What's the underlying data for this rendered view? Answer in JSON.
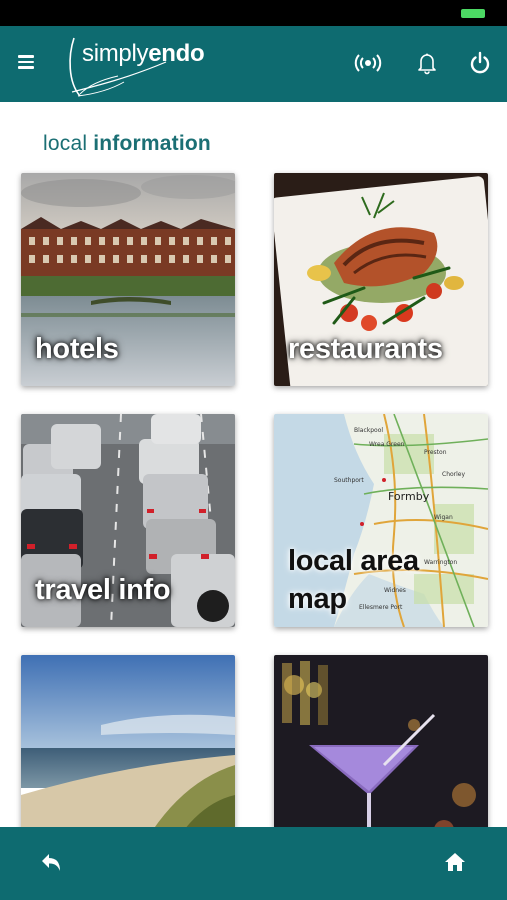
{
  "app": {
    "logo_name": "simplyendo",
    "logo_prefix": "simply",
    "logo_suffix": "endo"
  },
  "icons": {
    "menu": "menu-icon",
    "signal": "broadcast-icon",
    "bell": "bell-icon",
    "power": "power-icon",
    "back": "back-arrow-icon",
    "home": "home-icon"
  },
  "page": {
    "title_light": "local",
    "title_bold": "information"
  },
  "tiles": [
    {
      "label": "hotels"
    },
    {
      "label": "restaurants"
    },
    {
      "label": "travel info"
    },
    {
      "label_line1": "local area",
      "label_line2": "map"
    },
    {
      "label": ""
    },
    {
      "label": ""
    }
  ],
  "map_labels": [
    "Blackpool",
    "Wrea Green",
    "Preston",
    "Southport",
    "Formby",
    "Wigan",
    "Chorley",
    "Warrington",
    "Widnes",
    "Ellesmere Port"
  ],
  "colors": {
    "brand_teal": "#0e6b70",
    "title_teal": "#1b6f74",
    "battery_green": "#4cd964"
  }
}
